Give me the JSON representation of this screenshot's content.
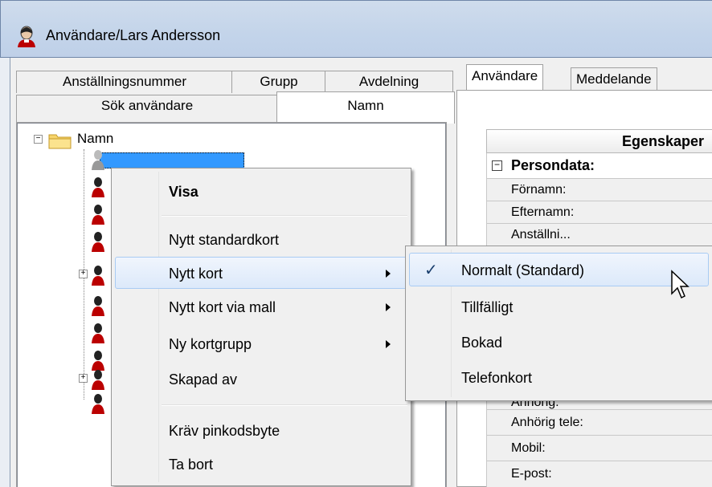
{
  "window": {
    "title": "Användare/Lars Andersson"
  },
  "left_tabs": {
    "row1": [
      "Anställningsnummer",
      "Grupp",
      "Avdelning"
    ],
    "row2": [
      "Sök användare",
      "Namn"
    ]
  },
  "tree": {
    "root_label": "Namn",
    "selected_item_label": "",
    "expand_symbol": "+",
    "collapse_symbol": "−"
  },
  "right_tabs": [
    "Användare",
    "Meddelande"
  ],
  "properties": {
    "header": "Egenskaper",
    "group": "Persondata:",
    "rows": [
      "Förnamn:",
      "Efternamn:",
      "Anställni...",
      "",
      "",
      "",
      "Anhörig:",
      "Anhörig tele:",
      "Mobil:",
      "E-post:"
    ]
  },
  "context_menu": {
    "items": [
      {
        "label": "Visa",
        "bold": true
      },
      {
        "label": "Nytt standardkort"
      },
      {
        "label": "Nytt kort",
        "submenu": true,
        "highlighted": true
      },
      {
        "label": "Nytt kort via mall",
        "submenu": true
      },
      {
        "label": "Ny kortgrupp",
        "submenu": true
      },
      {
        "label": "Skapad av"
      },
      {
        "label": "Kräv pinkodsbyte"
      },
      {
        "label": "Ta bort"
      }
    ]
  },
  "submenu": {
    "items": [
      {
        "label": "Normalt (Standard)",
        "checked": true,
        "highlighted": true
      },
      {
        "label": "Tillfälligt"
      },
      {
        "label": "Bokad"
      },
      {
        "label": "Telefonkort"
      }
    ],
    "check_glyph": "✓"
  },
  "colors": {
    "selection": "#3399ff",
    "menu_highlight_border": "#a8cbf3"
  }
}
